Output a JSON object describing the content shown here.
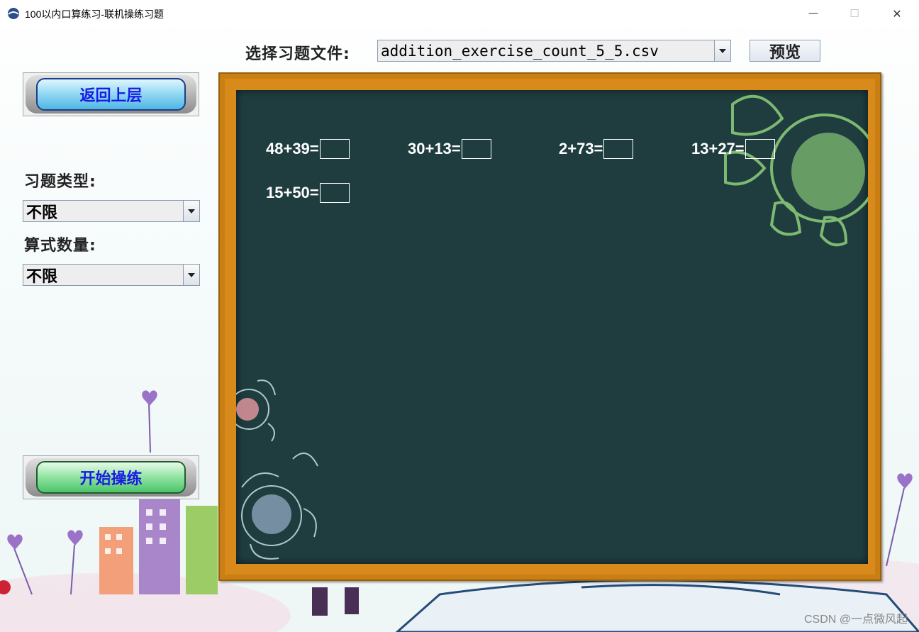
{
  "window": {
    "title": "100以内口算练习-联机操练习题",
    "minimize_symbol": "—",
    "maximize_symbol": "☐",
    "close_symbol": "✕"
  },
  "top": {
    "file_label": "选择习题文件:",
    "file_value": "addition_exercise_count_5_5.csv",
    "preview_label": "预览"
  },
  "sidebar": {
    "back_label": "返回上层",
    "type_label": "习题类型:",
    "type_value": "不限",
    "count_label": "算式数量:",
    "count_value": "不限",
    "start_label": "开始操练"
  },
  "board": {
    "equations": [
      {
        "expr": "48+39=",
        "answer": ""
      },
      {
        "expr": "30+13=",
        "answer": ""
      },
      {
        "expr": "2+73=",
        "answer": ""
      },
      {
        "expr": "13+27=",
        "answer": ""
      },
      {
        "expr": "15+50=",
        "answer": ""
      }
    ]
  },
  "watermark": "CSDN @一点微风起",
  "icons": {
    "app": "app-logo-icon",
    "dropdown": "chevron-down-icon"
  }
}
